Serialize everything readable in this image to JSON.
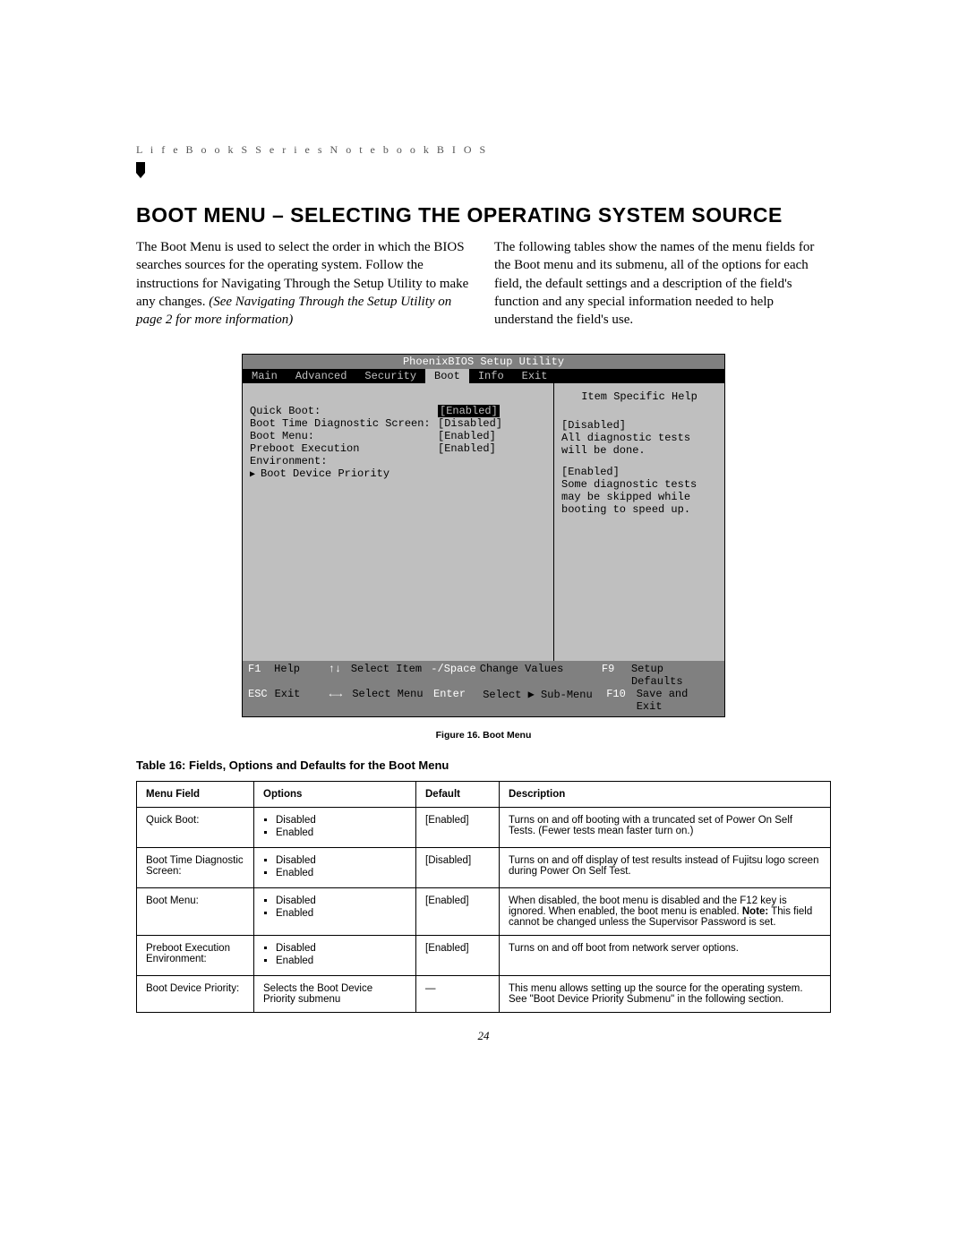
{
  "header": {
    "running": "L i f e B o o k   S   S e r i e s   N o t e b o o k   B I O S"
  },
  "title": "BOOT MENU – SELECTING THE OPERATING SYSTEM SOURCE",
  "intro": {
    "left_a": "The Boot Menu is used to select the order in which the BIOS searches sources for the operating system. Follow the instructions for Navigating Through the Setup Utility to make any changes. ",
    "left_b": "(See Navigating Through the Setup Utility on page 2 for more information)",
    "right": "The following tables show the names of the menu fields for the Boot menu and its submenu, all of the options for each field, the default settings and a description of the field's function and any special information needed to help understand the field's use."
  },
  "bios": {
    "title": "PhoenixBIOS Setup Utility",
    "tabs": [
      "Main",
      "Advanced",
      "Security",
      "Boot",
      "Info",
      "Exit"
    ],
    "active_tab_index": 3,
    "rows": [
      {
        "label": "Quick Boot:",
        "value": "[Enabled]",
        "selected": true
      },
      {
        "label": "Boot Time Diagnostic Screen:",
        "value": "[Disabled]"
      },
      {
        "label": "Boot Menu:",
        "value": "[Enabled]"
      },
      {
        "label": "Preboot Execution Environment:",
        "value": "[Enabled]"
      }
    ],
    "submenu": "Boot Device Priority",
    "help": {
      "title": "Item Specific Help",
      "blocks": [
        [
          "[Disabled]",
          "All diagnostic tests",
          "will be done."
        ],
        [
          "[Enabled]",
          "Some diagnostic tests",
          "may be skipped while",
          "booting to speed up."
        ]
      ]
    },
    "footer": [
      {
        "k1": "F1",
        "l1": "Help",
        "k2": "↑↓",
        "l2": "Select Item",
        "k3": "-/Space",
        "l3": "Change Values",
        "k4": "F9",
        "l4": "Setup Defaults"
      },
      {
        "k1": "ESC",
        "l1": "Exit",
        "k2": "←→",
        "l2": "Select Menu",
        "k3": "Enter",
        "l3": "Select ▶ Sub-Menu",
        "k4": "F10",
        "l4": "Save and Exit"
      }
    ]
  },
  "figure_caption": "Figure 16.   Boot Menu",
  "table_title": "Table 16: Fields, Options and Defaults for the Boot Menu",
  "table": {
    "headers": [
      "Menu Field",
      "Options",
      "Default",
      "Description"
    ],
    "rows": [
      {
        "field": "Quick Boot:",
        "options_list": [
          "Disabled",
          "Enabled"
        ],
        "default": "[Enabled]",
        "desc": "Turns on and off booting with a truncated set of Power On Self Tests. (Fewer tests mean faster turn on.)"
      },
      {
        "field": "Boot Time Diagnostic Screen:",
        "options_list": [
          "Disabled",
          "Enabled"
        ],
        "default": "[Disabled]",
        "desc": "Turns on and off display of test results instead of Fujitsu logo screen during Power On Self Test."
      },
      {
        "field": "Boot Menu:",
        "options_list": [
          "Disabled",
          "Enabled"
        ],
        "default": "[Enabled]",
        "desc_pre": "When disabled, the boot menu is disabled and the F12 key is ignored. When enabled, the boot menu is enabled. ",
        "desc_note": "Note:",
        "desc_post": " This field cannot be changed unless the Supervisor Password is set."
      },
      {
        "field": "Preboot Execution Environment:",
        "options_list": [
          "Disabled",
          "Enabled"
        ],
        "default": "[Enabled]",
        "desc": "Turns on and off boot from network server options."
      },
      {
        "field": "Boot Device Priority:",
        "options_text": "Selects the Boot Device Priority submenu",
        "default": "—",
        "desc": "This menu allows setting up the source for the operating system. See \"Boot Device Priority Submenu\" in the following section."
      }
    ]
  },
  "page_number": "24"
}
